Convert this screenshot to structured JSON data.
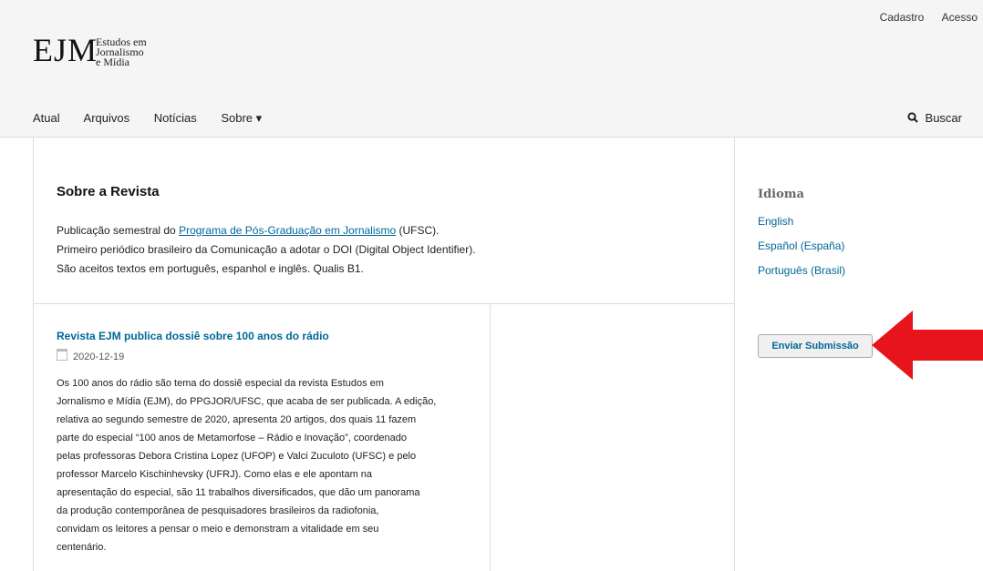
{
  "header": {
    "user_nav": {
      "register": "Cadastro",
      "login": "Acesso"
    },
    "logo": {
      "mark": "EJM",
      "line1": "Estudos em",
      "line2": "Jornalismo",
      "line3": "e Mídia"
    },
    "nav": [
      {
        "label": "Atual"
      },
      {
        "label": "Arquivos"
      },
      {
        "label": "Notícias"
      },
      {
        "label": "Sobre ▾"
      }
    ],
    "search": {
      "icon": "search-icon",
      "label": "Buscar"
    }
  },
  "about": {
    "title": "Sobre a Revista",
    "line1_prefix": "Publicação semestral do ",
    "line1_link": "Programa de Pós-Graduação em Jornalismo",
    "line1_suffix": " (UFSC).",
    "line2": "Primeiro periódico brasileiro da Comunicação a adotar o DOI (Digital Object Identifier).",
    "line3": "São aceitos textos em português, espanhol e inglês. Qualis B1."
  },
  "news": {
    "title": "Revista EJM publica dossiê sobre 100 anos do rádio",
    "date_icon": "calendar-icon",
    "date": "2020-12-19",
    "lines": [
      "Os 100 anos do rádio são tema do dossiê especial da revista Estudos em",
      "Jornalismo e Mídia (EJM), do PPGJOR/UFSC, que acaba de ser publicada. A edição,",
      "relativa ao segundo semestre de 2020, apresenta 20 artigos, dos quais 11 fazem",
      "parte do especial “100 anos de Metamorfose – Rádio e Inovação”, coordenado",
      "pelas professoras Debora Cristina Lopez (UFOP) e Valci Zuculoto (UFSC) e pelo",
      "professor Marcelo Kischinhevsky (UFRJ). Como elas e ele apontam na",
      "apresentação do especial, são 11 trabalhos diversificados, que dão um panorama",
      "da produção contemporânea de pesquisadores brasileiros da radiofonia,",
      "convidam os leitores a pensar o meio e demonstram a vitalidade em seu",
      "centenário."
    ]
  },
  "sidebar": {
    "language_title": "Idioma",
    "languages": [
      "English",
      "Español (España)",
      "Português (Brasil)"
    ],
    "submit_label": "Enviar Submissão"
  },
  "colors": {
    "link": "#006798",
    "arrow": "#e8141c",
    "header_bg": "#f5f5f5",
    "border": "#dddddd"
  }
}
